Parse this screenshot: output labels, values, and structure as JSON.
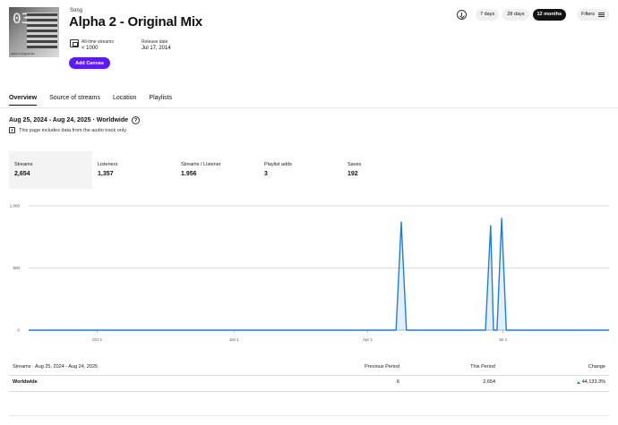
{
  "song": {
    "type_label": "Song",
    "title": "Alpha 2 - Original Mix",
    "artwork_number": "03",
    "artwork_caption": "Alpha 2 Original Mix",
    "all_time_streams_label": "All-time streams",
    "all_time_streams_value": "< 1000",
    "release_date_label": "Release date",
    "release_date_value": "Jul 17, 2014",
    "add_canvas_label": "Add Canvas"
  },
  "controls": {
    "ranges": [
      {
        "label": "7 days",
        "active": false
      },
      {
        "label": "28 days",
        "active": false
      },
      {
        "label": "12 months",
        "active": true
      }
    ],
    "filters_label": "Filters"
  },
  "tabs": [
    {
      "label": "Overview",
      "active": true
    },
    {
      "label": "Source of streams",
      "active": false
    },
    {
      "label": "Location",
      "active": false
    },
    {
      "label": "Playlists",
      "active": false
    }
  ],
  "range_title": "Aug 25, 2024 - Aug 24, 2025 · Worldwide",
  "note": "This page includes data from the audio track only.",
  "metrics": [
    {
      "label": "Streams",
      "value": "2,654",
      "active": true
    },
    {
      "label": "Listeners",
      "value": "1,357",
      "active": false
    },
    {
      "label": "Streams / Listener",
      "value": "1.956",
      "active": false
    },
    {
      "label": "Playlist adds",
      "value": "3",
      "active": false
    },
    {
      "label": "Saves",
      "value": "192",
      "active": false
    }
  ],
  "chart_data": {
    "type": "line",
    "series": [
      {
        "name": "Streams",
        "points": [
          [
            0,
            0
          ],
          [
            0.633,
            0
          ],
          [
            0.642,
            870
          ],
          [
            0.651,
            0
          ],
          [
            0.787,
            0
          ],
          [
            0.796,
            840
          ],
          [
            0.801,
            0
          ],
          [
            0.807,
            0
          ],
          [
            0.815,
            900
          ],
          [
            0.823,
            0
          ],
          [
            1,
            0
          ]
        ]
      }
    ],
    "x_ticks": [
      {
        "label": "Oct 1",
        "pos": 0.118
      },
      {
        "label": "Jan 1",
        "pos": 0.354
      },
      {
        "label": "Apr 1",
        "pos": 0.584
      },
      {
        "label": "Jul 1",
        "pos": 0.817
      }
    ],
    "y_ticks": [
      {
        "label": "1,000",
        "value": 1000
      },
      {
        "label": "500",
        "value": 500
      },
      {
        "label": "0",
        "value": 0
      }
    ],
    "ylim": [
      0,
      1000
    ],
    "line_color": "#1f7fd6"
  },
  "table": {
    "headers": {
      "name": "Streams · Aug 25, 2024 - Aug 24, 2025",
      "previous": "Previous Period",
      "current": "This Period",
      "change": "Change"
    },
    "rows": [
      {
        "name": "Worldwide",
        "previous": "6",
        "current": "2,654",
        "change": "44,133.3%"
      }
    ]
  }
}
